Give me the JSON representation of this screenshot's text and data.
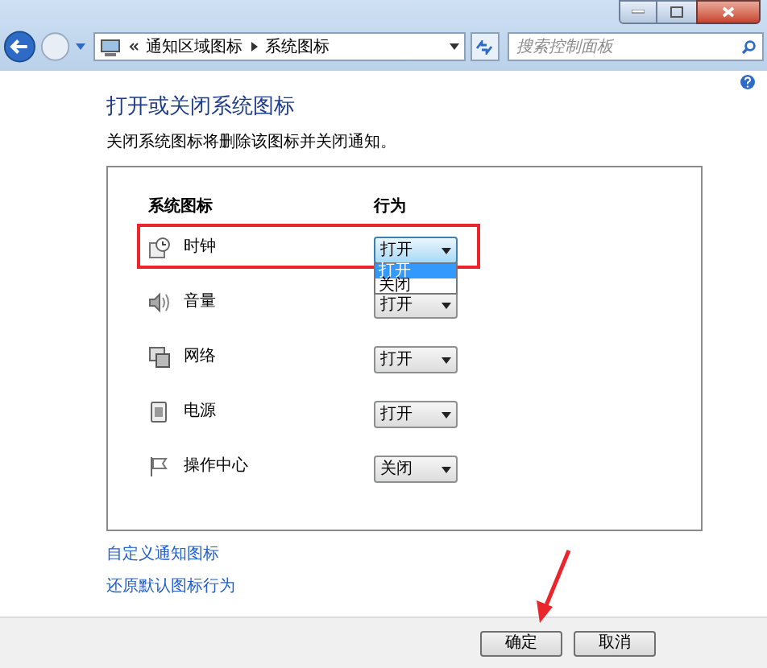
{
  "address_bar": {
    "breadcrumbs": [
      "通知区域图标",
      "系统图标"
    ]
  },
  "search": {
    "placeholder": "搜索控制面板"
  },
  "heading": "打开或关闭系统图标",
  "description": "关闭系统图标将删除该图标并关闭通知。",
  "table": {
    "columns": [
      "系统图标",
      "行为"
    ],
    "rows": [
      {
        "name": "时钟",
        "value": "打开",
        "highlighted": true,
        "expanded": true,
        "options": [
          {
            "label": "打开",
            "selected": true
          },
          {
            "label": "关闭",
            "selected": false
          }
        ]
      },
      {
        "name": "音量",
        "value": "打开",
        "highlighted": false,
        "expanded": false
      },
      {
        "name": "网络",
        "value": "打开",
        "highlighted": false,
        "expanded": false
      },
      {
        "name": "电源",
        "value": "打开",
        "highlighted": false,
        "expanded": false
      },
      {
        "name": "操作中心",
        "value": "关闭",
        "highlighted": false,
        "expanded": false
      }
    ]
  },
  "links": [
    "自定义通知图标",
    "还原默认图标行为"
  ],
  "buttons": [
    "确定",
    "取消"
  ]
}
